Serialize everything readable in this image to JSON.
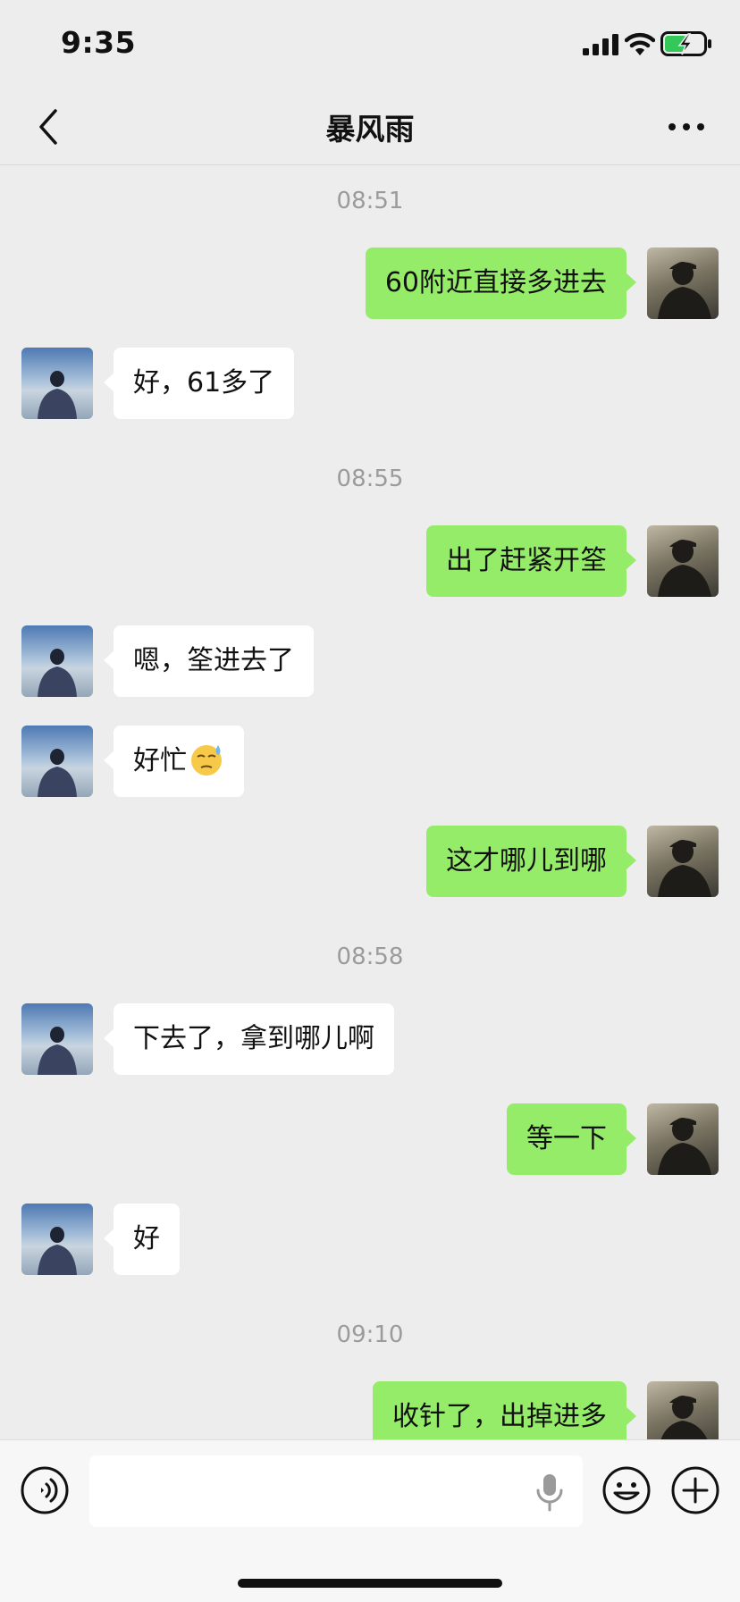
{
  "status_bar": {
    "time": "9:35"
  },
  "header": {
    "title": "暴风雨"
  },
  "messages": {
    "ts1": "08:51",
    "m1": "60附近直接多进去",
    "m2": "好，61多了",
    "ts2": "08:55",
    "m3": "出了赶紧开筌",
    "m4": "嗯，筌进去了",
    "m5": "好忙",
    "ts3": "08:58",
    "m6": "这才哪儿到哪",
    "m7": "下去了，拿到哪儿啊",
    "m8": "等一下",
    "m9": "好",
    "ts4": "09:10",
    "m10": "收针了，出掉进多"
  },
  "icons": {
    "back": "chevron-left-icon",
    "more": "more-dots-icon",
    "voice": "voice-icon",
    "mic": "mic-icon",
    "emoji": "emoji-icon",
    "plus": "plus-icon",
    "inline_emoji": "sweat-face-icon"
  },
  "colors": {
    "sent_bubble": "#95ec69",
    "received_bubble": "#ffffff",
    "background": "#ededed"
  },
  "input": {
    "value": "",
    "placeholder": ""
  }
}
